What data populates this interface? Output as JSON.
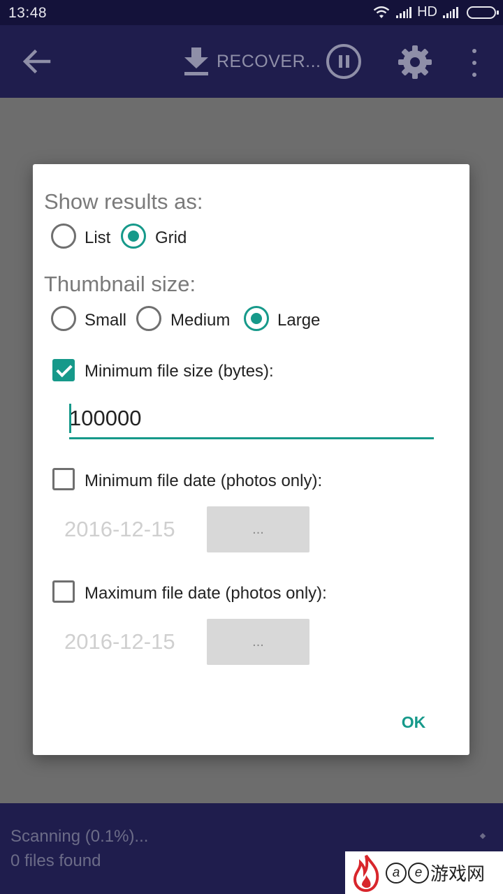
{
  "status_bar": {
    "time": "13:48",
    "network": "HD"
  },
  "toolbar": {
    "recover_label": "RECOVER..."
  },
  "dialog": {
    "show_results": {
      "title": "Show results as:",
      "options": [
        {
          "label": "List",
          "selected": false
        },
        {
          "label": "Grid",
          "selected": true
        }
      ]
    },
    "thumbnail": {
      "title": "Thumbnail size:",
      "options": [
        {
          "label": "Small",
          "selected": false
        },
        {
          "label": "Medium",
          "selected": false
        },
        {
          "label": "Large",
          "selected": true
        }
      ]
    },
    "min_size": {
      "label": "Minimum file size (bytes):",
      "checked": true,
      "value": "100000"
    },
    "min_date": {
      "label": "Minimum file date (photos only):",
      "checked": false,
      "date": "2016-12-15",
      "button": "..."
    },
    "max_date": {
      "label": "Maximum file date (photos only):",
      "checked": false,
      "date": "2016-12-15",
      "button": "..."
    },
    "ok_label": "OK"
  },
  "bottom": {
    "scan_status": "Scanning (0.1%)...",
    "files_found": "0 files found"
  },
  "watermark": {
    "letters": [
      "a",
      "e"
    ],
    "text": "游戏网"
  },
  "colors": {
    "accent": "#16998a",
    "toolbar": "#1f1d4d",
    "status_bar": "#14123a"
  }
}
